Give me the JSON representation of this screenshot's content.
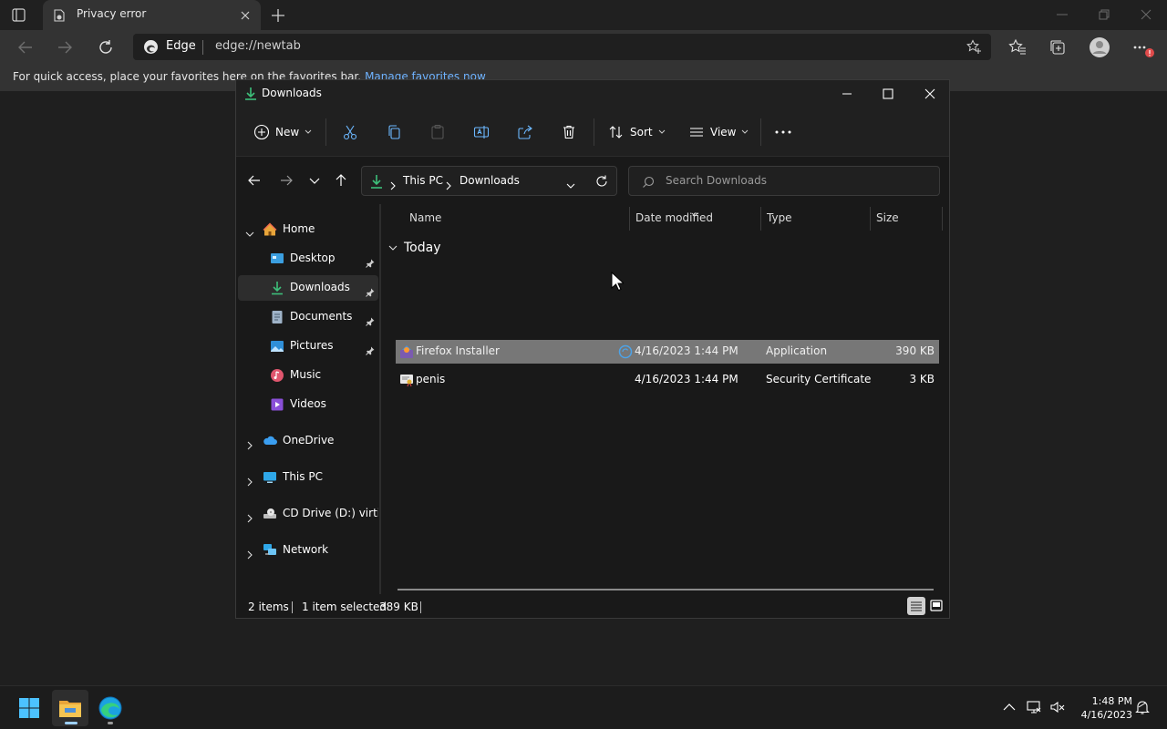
{
  "browser": {
    "tab_title": "Privacy error",
    "edge_label": "Edge",
    "url": "edge://newtab",
    "favbar_text": "For quick access, place your favorites here on the favorites bar.",
    "favbar_link": "Manage favorites now"
  },
  "explorer": {
    "title": "Downloads",
    "commands": {
      "new": "New",
      "sort": "Sort",
      "view": "View"
    },
    "breadcrumb": [
      "This PC",
      "Downloads"
    ],
    "search_placeholder": "Search Downloads",
    "sidebar": {
      "items": [
        {
          "label": "Home",
          "icon": "home-icon"
        },
        {
          "label": "Desktop",
          "icon": "desktop-icon"
        },
        {
          "label": "Downloads",
          "icon": "downloads-icon"
        },
        {
          "label": "Documents",
          "icon": "documents-icon"
        },
        {
          "label": "Pictures",
          "icon": "pictures-icon"
        },
        {
          "label": "Music",
          "icon": "music-icon"
        },
        {
          "label": "Videos",
          "icon": "videos-icon"
        },
        {
          "label": "OneDrive",
          "icon": "onedrive-icon"
        },
        {
          "label": "This PC",
          "icon": "this-pc-icon"
        },
        {
          "label": "CD Drive (D:) virtio-win",
          "icon": "cd-drive-icon"
        },
        {
          "label": "Network",
          "icon": "network-icon"
        }
      ]
    },
    "columns": [
      "Name",
      "Date modified",
      "Type",
      "Size"
    ],
    "group_label": "Today",
    "files": [
      {
        "name": "Firefox Installer",
        "date": "4/16/2023 1:44 PM",
        "type": "Application",
        "size": "390 KB",
        "selected": true
      },
      {
        "name": "penis",
        "date": "4/16/2023 1:44 PM",
        "type": "Security Certificate",
        "size": "3 KB",
        "selected": false
      }
    ],
    "status": {
      "items": "2 items",
      "selection": "1 item selected",
      "size": "389 KB"
    }
  },
  "taskbar": {
    "time": "1:48 PM",
    "date": "4/16/2023"
  },
  "colors": {
    "accent": "#4cc2ff",
    "download_green": "#3dbf7a",
    "selection": "#777777"
  }
}
